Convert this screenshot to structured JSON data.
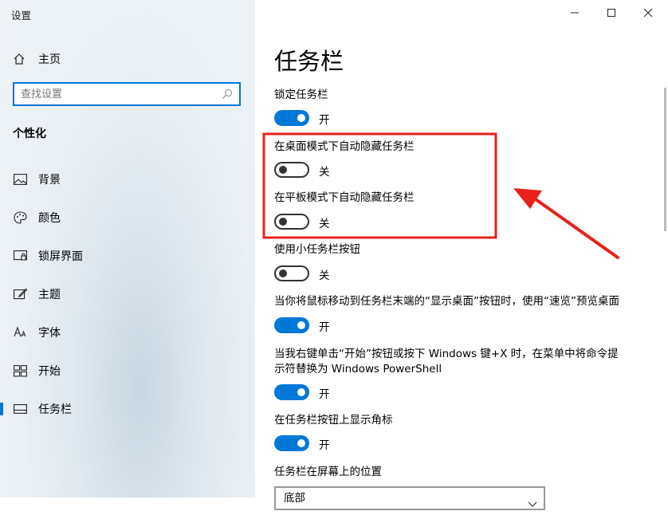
{
  "app": {
    "title": "设置"
  },
  "sidebar": {
    "home_label": "主页",
    "search_placeholder": "查找设置",
    "section_title": "个性化",
    "items": [
      {
        "label": "背景",
        "icon": "picture-icon"
      },
      {
        "label": "颜色",
        "icon": "palette-icon"
      },
      {
        "label": "锁屏界面",
        "icon": "lock-screen-icon"
      },
      {
        "label": "主题",
        "icon": "theme-brush-icon"
      },
      {
        "label": "字体",
        "icon": "font-icon"
      },
      {
        "label": "开始",
        "icon": "start-tiles-icon"
      },
      {
        "label": "任务栏",
        "icon": "taskbar-icon",
        "active": true
      }
    ]
  },
  "main": {
    "title": "任务栏",
    "settings": [
      {
        "label": "锁定任务栏",
        "on": true,
        "state": "开"
      },
      {
        "label": "在桌面模式下自动隐藏任务栏",
        "on": false,
        "state": "关"
      },
      {
        "label": "在平板模式下自动隐藏任务栏",
        "on": false,
        "state": "关"
      },
      {
        "label": "使用小任务栏按钮",
        "on": false,
        "state": "关"
      },
      {
        "label": "当你将鼠标移动到任务栏末端的“显示桌面”按钮时，使用“速览”预览桌面",
        "on": true,
        "state": "开"
      },
      {
        "label_line1": "当我右键单击“开始”按钮或按下 Windows 键+X 时，在菜单中将命令提",
        "label_line2": "示符替换为 Windows PowerShell",
        "on": true,
        "state": "开"
      },
      {
        "label": "在任务栏按钮上显示角标",
        "on": true,
        "state": "开"
      }
    ],
    "position_label": "任务栏在屏幕上的位置",
    "position_value": "底部"
  },
  "annotation": {
    "color": "#e8211b"
  },
  "colors": {
    "accent": "#0078d7"
  }
}
